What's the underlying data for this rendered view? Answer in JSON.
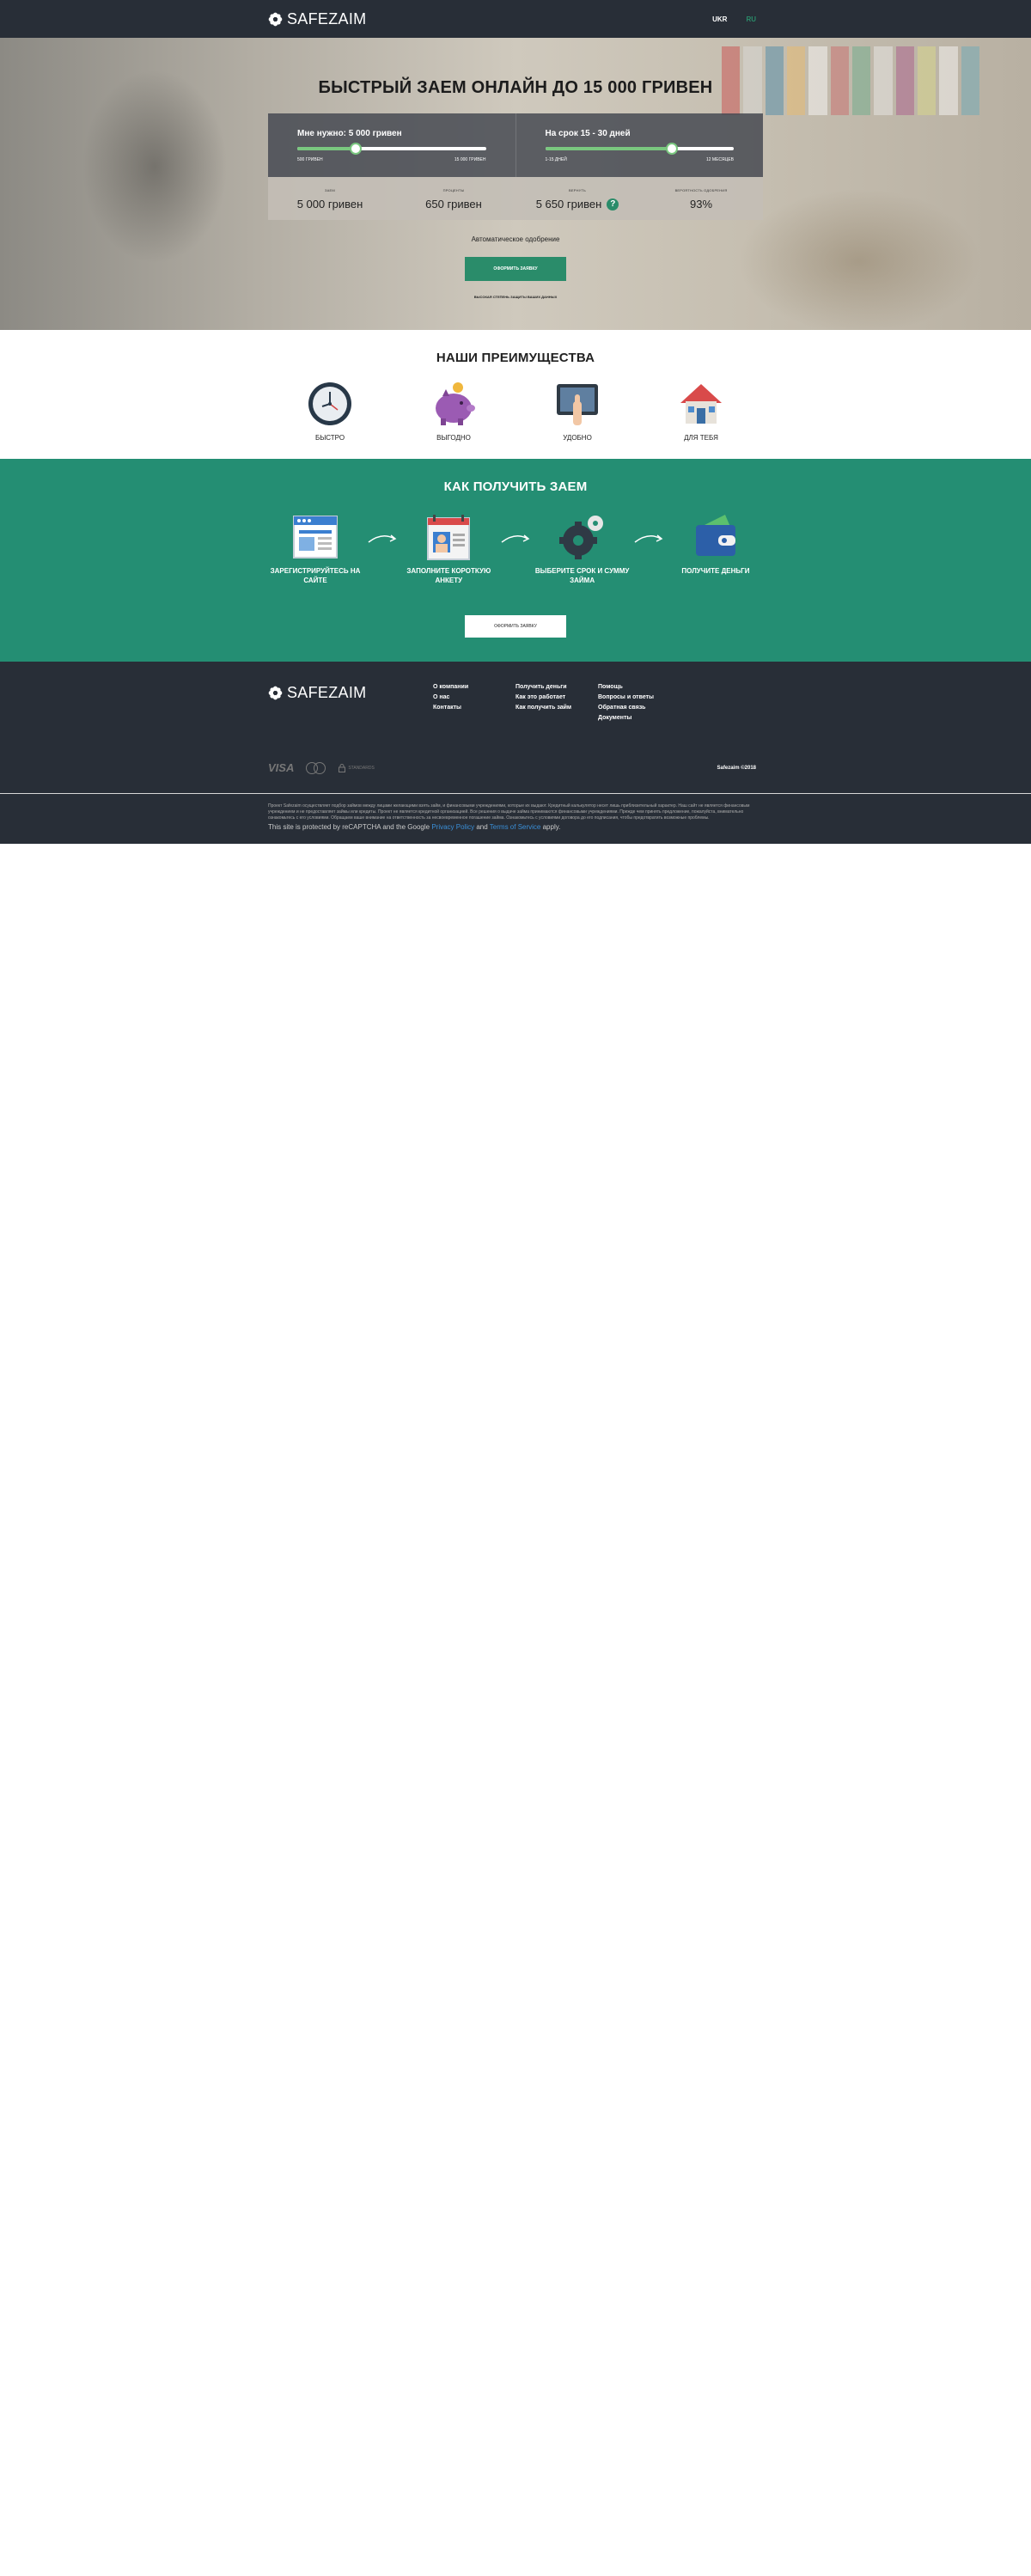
{
  "header": {
    "logo": "SAFEZAIM",
    "lang_ukr": "UKR",
    "lang_ru": "RU"
  },
  "hero": {
    "title": "БЫСТРЫЙ ЗАЕМ ОНЛАЙН ДО 15 000 ГРИВЕН",
    "amount_slider": {
      "title": "Мне нужно: 5 000 гривен",
      "min_label": "500 ГРИВЕН",
      "max_label": "15 000 ГРИВЕН",
      "min": 500,
      "max": 15000,
      "value": 5000
    },
    "term_slider": {
      "title": "На срок 15 - 30 дней",
      "min_label": "1-15 ДНЕЙ",
      "max_label": "12 МЕСЯЦЕВ",
      "level": 0.67
    },
    "stats": [
      {
        "label": "ЗАЕМ",
        "value": "5 000 гривен"
      },
      {
        "label": "ПРОЦЕНТЫ",
        "value": "650 гривен"
      },
      {
        "label": "ВЕРНУТЬ",
        "value": "5 650 гривен",
        "help": "?"
      },
      {
        "label": "ВЕРОЯТНОСТЬ ОДОБРЕНИЯ",
        "value": "93%"
      }
    ],
    "auto_approve": "Автоматическое одобрение",
    "apply_button": "ОФОРМИТЬ ЗАЯВКУ",
    "note": "ВЫСОКАЯ СТЕПЕНЬ ЗАЩИТЫ ВАШИХ ДАННЫХ"
  },
  "advantages": {
    "title": "НАШИ ПРЕИМУЩЕСТВА",
    "items": [
      {
        "label": "БЫСТРО",
        "icon": "clock-icon"
      },
      {
        "label": "ВЫГОДНО",
        "icon": "piggy-bank-icon"
      },
      {
        "label": "УДОБНО",
        "icon": "tablet-icon"
      },
      {
        "label": "ДЛЯ ТЕБЯ",
        "icon": "house-icon"
      }
    ]
  },
  "howto": {
    "title": "КАК ПОЛУЧИТЬ ЗАЕМ",
    "steps": [
      {
        "label": "ЗАРЕГИСТРИРУЙТЕСЬ НА САЙТЕ",
        "icon": "browser-window-icon"
      },
      {
        "label": "ЗАПОЛНИТЕ КОРОТКУЮ АНКЕТУ",
        "icon": "profile-form-icon"
      },
      {
        "label": "ВЫБЕРИТЕ СРОК И СУММУ ЗАЙМА",
        "icon": "gears-icon"
      },
      {
        "label": "ПОЛУЧИТЕ ДЕНЬГИ",
        "icon": "wallet-icon"
      }
    ],
    "button": "ОФОРМИТЬ ЗАЯВКУ"
  },
  "footer": {
    "logo": "SAFEZAIM",
    "col1": [
      "О компании",
      "О нас",
      "Контакты"
    ],
    "col2": [
      "Получить деньги",
      "Как это работает",
      "Как получить займ"
    ],
    "col3": [
      "Помощь",
      "Вопросы и ответы",
      "Обратная связь",
      "Документы"
    ],
    "payments": {
      "visa": "VISA",
      "secure": "STANDARDS"
    },
    "copyright": "Safezaim ©2018",
    "legal_text": "Проект Safezaim осуществляет подбор займов между лицами желающими взять займ, и финансовыми учреждениями, которые их выдают. Кредитный калькулятор несет лишь приблизительный характер. Наш сайт не является финансовым учреждением и не предоставляет займы или кредиты. Проект не является кредитной организацией. Все решения о выдаче займа принимаются финансовыми учреждениями. Прежде чем принять предложение, пожалуйста, внимательно ознакомьтесь с его условиями. Обращаем ваше внимание на ответственность за несвоевременное погашение займа. Ознакомьтесь с условиями договора до его подписания, чтобы предотвратить возможные проблемы.",
    "recaptcha_prefix": "This site is protected by reCAPTCHA and the Google",
    "privacy": "Privacy Policy",
    "and": "and",
    "terms": "Terms of Service",
    "apply": "apply."
  },
  "colors": {
    "header_bg": "#282e37",
    "accent_green": "#2a8c6a",
    "section_green": "#248e73",
    "slider_fill": "#7ac77f"
  }
}
